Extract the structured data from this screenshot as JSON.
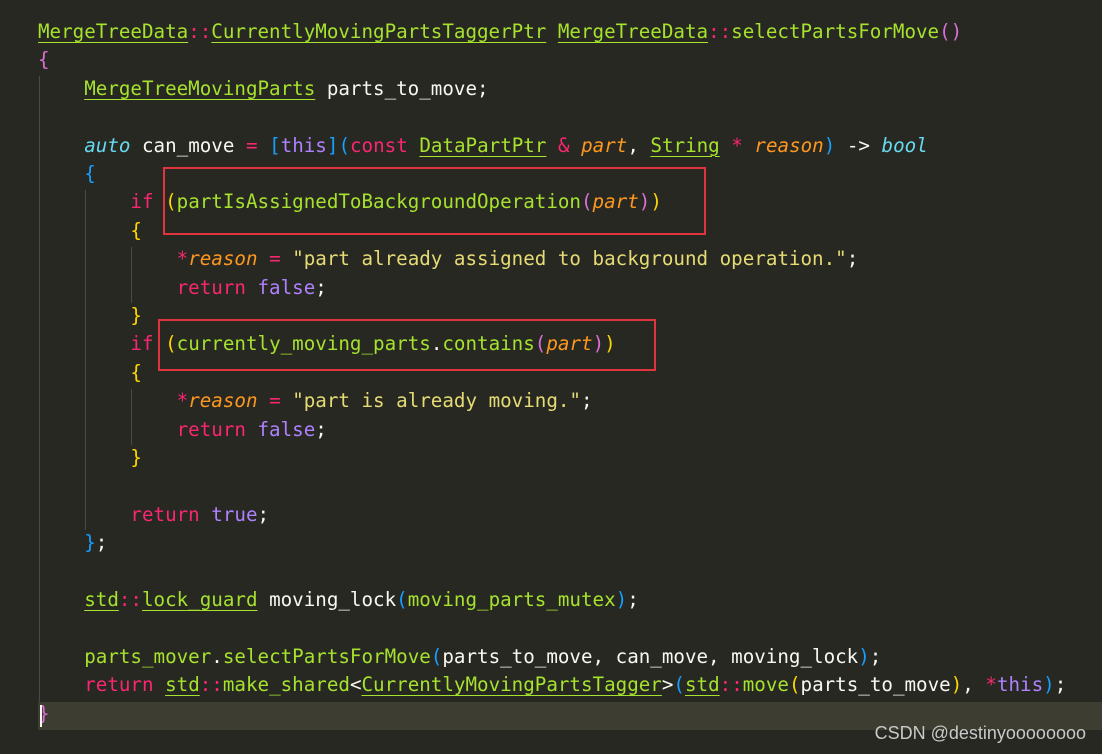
{
  "editor": {
    "theme": {
      "background": "#272822",
      "current_line_background": "#3e3d32",
      "default_text": "#f8f8f2",
      "type_green": "#a6e22e",
      "keyword_pink": "#f92672",
      "storage_cyan": "#66d9ef",
      "param_orange": "#fd971f",
      "string_yellow": "#e6db74",
      "constant_purple": "#ae81ff",
      "bracket_gold": "#ffd700",
      "bracket_magenta": "#da70d6",
      "bracket_blue": "#179fff",
      "annotation_red": "#e0343f"
    },
    "lines": [
      {
        "tokens": [
          {
            "t": "MergeTreeData",
            "c": "type_green",
            "u": true
          },
          {
            "t": "::",
            "c": "keyword_pink"
          },
          {
            "t": "CurrentlyMovingPartsTaggerPtr",
            "c": "type_green",
            "u": true
          },
          {
            "t": " ",
            "c": "default_text"
          },
          {
            "t": "MergeTreeData",
            "c": "type_green",
            "u": true
          },
          {
            "t": "::",
            "c": "keyword_pink"
          },
          {
            "t": "selectPartsForMove",
            "c": "type_green"
          },
          {
            "t": "()",
            "c": "bracket_magenta"
          }
        ]
      },
      {
        "tokens": [
          {
            "t": "{",
            "c": "bracket_magenta"
          }
        ]
      },
      {
        "tokens": [
          {
            "t": "    ",
            "c": "default_text"
          },
          {
            "t": "MergeTreeMovingParts",
            "c": "type_green",
            "u": true
          },
          {
            "t": " parts_to_move;",
            "c": "default_text"
          }
        ]
      },
      {
        "tokens": []
      },
      {
        "tokens": [
          {
            "t": "    ",
            "c": "default_text"
          },
          {
            "t": "auto",
            "c": "storage_cyan",
            "i": true
          },
          {
            "t": " can_move ",
            "c": "default_text"
          },
          {
            "t": "=",
            "c": "keyword_pink"
          },
          {
            "t": " ",
            "c": "default_text"
          },
          {
            "t": "[",
            "c": "bracket_blue"
          },
          {
            "t": "this",
            "c": "constant_purple"
          },
          {
            "t": "]",
            "c": "bracket_blue"
          },
          {
            "t": "(",
            "c": "bracket_blue"
          },
          {
            "t": "const",
            "c": "keyword_pink"
          },
          {
            "t": " ",
            "c": "default_text"
          },
          {
            "t": "DataPartPtr",
            "c": "type_green",
            "u": true
          },
          {
            "t": " ",
            "c": "default_text"
          },
          {
            "t": "&",
            "c": "keyword_pink"
          },
          {
            "t": " ",
            "c": "default_text"
          },
          {
            "t": "part",
            "c": "param_orange",
            "i": true
          },
          {
            "t": ", ",
            "c": "default_text"
          },
          {
            "t": "String",
            "c": "type_green",
            "u": true
          },
          {
            "t": " ",
            "c": "default_text"
          },
          {
            "t": "*",
            "c": "keyword_pink"
          },
          {
            "t": " ",
            "c": "default_text"
          },
          {
            "t": "reason",
            "c": "param_orange",
            "i": true
          },
          {
            "t": ")",
            "c": "bracket_blue"
          },
          {
            "t": " -> ",
            "c": "default_text"
          },
          {
            "t": "bool",
            "c": "storage_cyan",
            "i": true
          }
        ]
      },
      {
        "tokens": [
          {
            "t": "    ",
            "c": "default_text"
          },
          {
            "t": "{",
            "c": "bracket_blue"
          }
        ]
      },
      {
        "tokens": [
          {
            "t": "        ",
            "c": "default_text"
          },
          {
            "t": "if",
            "c": "keyword_pink"
          },
          {
            "t": " ",
            "c": "default_text"
          },
          {
            "t": "(",
            "c": "bracket_gold"
          },
          {
            "t": "partIsAssignedToBackgroundOperation",
            "c": "type_green"
          },
          {
            "t": "(",
            "c": "bracket_magenta"
          },
          {
            "t": "part",
            "c": "param_orange",
            "i": true
          },
          {
            "t": ")",
            "c": "bracket_magenta"
          },
          {
            "t": ")",
            "c": "bracket_gold"
          }
        ]
      },
      {
        "tokens": [
          {
            "t": "        ",
            "c": "default_text"
          },
          {
            "t": "{",
            "c": "bracket_gold"
          }
        ]
      },
      {
        "tokens": [
          {
            "t": "            ",
            "c": "default_text"
          },
          {
            "t": "*",
            "c": "keyword_pink"
          },
          {
            "t": "reason",
            "c": "param_orange",
            "i": true
          },
          {
            "t": " ",
            "c": "default_text"
          },
          {
            "t": "=",
            "c": "keyword_pink"
          },
          {
            "t": " ",
            "c": "default_text"
          },
          {
            "t": "\"part already assigned to background operation.\"",
            "c": "string_yellow"
          },
          {
            "t": ";",
            "c": "default_text"
          }
        ]
      },
      {
        "tokens": [
          {
            "t": "            ",
            "c": "default_text"
          },
          {
            "t": "return",
            "c": "keyword_pink"
          },
          {
            "t": " ",
            "c": "default_text"
          },
          {
            "t": "false",
            "c": "constant_purple"
          },
          {
            "t": ";",
            "c": "default_text"
          }
        ]
      },
      {
        "tokens": [
          {
            "t": "        ",
            "c": "default_text"
          },
          {
            "t": "}",
            "c": "bracket_gold"
          }
        ]
      },
      {
        "tokens": [
          {
            "t": "        ",
            "c": "default_text"
          },
          {
            "t": "if",
            "c": "keyword_pink"
          },
          {
            "t": " ",
            "c": "default_text"
          },
          {
            "t": "(",
            "c": "bracket_gold"
          },
          {
            "t": "currently_moving_parts",
            "c": "type_green"
          },
          {
            "t": ".",
            "c": "default_text"
          },
          {
            "t": "contains",
            "c": "type_green"
          },
          {
            "t": "(",
            "c": "bracket_magenta"
          },
          {
            "t": "part",
            "c": "param_orange",
            "i": true
          },
          {
            "t": ")",
            "c": "bracket_magenta"
          },
          {
            "t": ")",
            "c": "bracket_gold"
          }
        ]
      },
      {
        "tokens": [
          {
            "t": "        ",
            "c": "default_text"
          },
          {
            "t": "{",
            "c": "bracket_gold"
          }
        ]
      },
      {
        "tokens": [
          {
            "t": "            ",
            "c": "default_text"
          },
          {
            "t": "*",
            "c": "keyword_pink"
          },
          {
            "t": "reason",
            "c": "param_orange",
            "i": true
          },
          {
            "t": " ",
            "c": "default_text"
          },
          {
            "t": "=",
            "c": "keyword_pink"
          },
          {
            "t": " ",
            "c": "default_text"
          },
          {
            "t": "\"part is already moving.\"",
            "c": "string_yellow"
          },
          {
            "t": ";",
            "c": "default_text"
          }
        ]
      },
      {
        "tokens": [
          {
            "t": "            ",
            "c": "default_text"
          },
          {
            "t": "return",
            "c": "keyword_pink"
          },
          {
            "t": " ",
            "c": "default_text"
          },
          {
            "t": "false",
            "c": "constant_purple"
          },
          {
            "t": ";",
            "c": "default_text"
          }
        ]
      },
      {
        "tokens": [
          {
            "t": "        ",
            "c": "default_text"
          },
          {
            "t": "}",
            "c": "bracket_gold"
          }
        ]
      },
      {
        "tokens": []
      },
      {
        "tokens": [
          {
            "t": "        ",
            "c": "default_text"
          },
          {
            "t": "return",
            "c": "keyword_pink"
          },
          {
            "t": " ",
            "c": "default_text"
          },
          {
            "t": "true",
            "c": "constant_purple"
          },
          {
            "t": ";",
            "c": "default_text"
          }
        ]
      },
      {
        "tokens": [
          {
            "t": "    ",
            "c": "default_text"
          },
          {
            "t": "}",
            "c": "bracket_blue"
          },
          {
            "t": ";",
            "c": "default_text"
          }
        ]
      },
      {
        "tokens": []
      },
      {
        "tokens": [
          {
            "t": "    ",
            "c": "default_text"
          },
          {
            "t": "std",
            "c": "type_green",
            "u": true
          },
          {
            "t": "::",
            "c": "keyword_pink"
          },
          {
            "t": "lock_guard",
            "c": "type_green",
            "u": true
          },
          {
            "t": " moving_lock",
            "c": "default_text"
          },
          {
            "t": "(",
            "c": "bracket_blue"
          },
          {
            "t": "moving_parts_mutex",
            "c": "type_green"
          },
          {
            "t": ")",
            "c": "bracket_blue"
          },
          {
            "t": ";",
            "c": "default_text"
          }
        ]
      },
      {
        "tokens": []
      },
      {
        "tokens": [
          {
            "t": "    ",
            "c": "default_text"
          },
          {
            "t": "parts_mover",
            "c": "type_green"
          },
          {
            "t": ".",
            "c": "default_text"
          },
          {
            "t": "selectPartsForMove",
            "c": "type_green"
          },
          {
            "t": "(",
            "c": "bracket_blue"
          },
          {
            "t": "parts_to_move, can_move, moving_lock",
            "c": "default_text"
          },
          {
            "t": ")",
            "c": "bracket_blue"
          },
          {
            "t": ";",
            "c": "default_text"
          }
        ]
      },
      {
        "tokens": [
          {
            "t": "    ",
            "c": "default_text"
          },
          {
            "t": "return",
            "c": "keyword_pink"
          },
          {
            "t": " ",
            "c": "default_text"
          },
          {
            "t": "std",
            "c": "type_green",
            "u": true
          },
          {
            "t": "::",
            "c": "keyword_pink"
          },
          {
            "t": "make_shared",
            "c": "type_green"
          },
          {
            "t": "<",
            "c": "default_text"
          },
          {
            "t": "CurrentlyMovingPartsTagger",
            "c": "type_green",
            "u": true
          },
          {
            "t": ">",
            "c": "default_text"
          },
          {
            "t": "(",
            "c": "bracket_blue"
          },
          {
            "t": "std",
            "c": "type_green",
            "u": true
          },
          {
            "t": "::",
            "c": "keyword_pink"
          },
          {
            "t": "move",
            "c": "type_green"
          },
          {
            "t": "(",
            "c": "bracket_gold"
          },
          {
            "t": "parts_to_move",
            "c": "default_text"
          },
          {
            "t": ")",
            "c": "bracket_gold"
          },
          {
            "t": ", ",
            "c": "default_text"
          },
          {
            "t": "*",
            "c": "keyword_pink"
          },
          {
            "t": "this",
            "c": "constant_purple"
          },
          {
            "t": ")",
            "c": "bracket_blue"
          },
          {
            "t": ";",
            "c": "default_text"
          }
        ]
      },
      {
        "tokens": [
          {
            "t": "}",
            "c": "bracket_magenta"
          }
        ]
      }
    ]
  },
  "watermark": "CSDN @destinyoooooooo"
}
